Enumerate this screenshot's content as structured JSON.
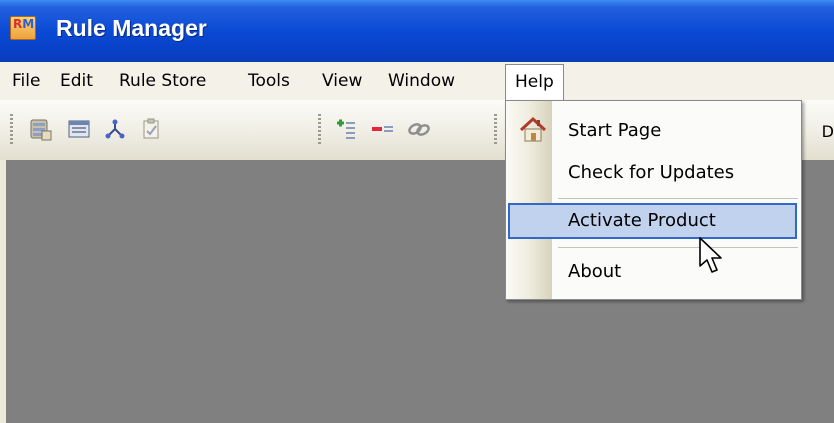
{
  "window": {
    "app_icon_text_r": "R",
    "app_icon_text_m": "M",
    "title": "Rule Manager"
  },
  "menubar": {
    "items": [
      {
        "label": "File"
      },
      {
        "label": "Edit"
      },
      {
        "label": "Rule Store"
      },
      {
        "label": "Tools"
      },
      {
        "label": "View"
      },
      {
        "label": "Window"
      },
      {
        "label": "Help"
      }
    ]
  },
  "toolbar": {
    "icons": [
      "database-icon",
      "window-icon",
      "nodes-icon",
      "checklist-icon",
      "add-rule-icon",
      "remove-rule-icon",
      "link-icon"
    ],
    "edge_text": "D"
  },
  "help_menu": {
    "items": [
      {
        "label": "Start Page",
        "icon": "home-icon"
      },
      {
        "label": "Check for Updates"
      },
      {
        "label": "Activate Product",
        "highlighted": true
      },
      {
        "label": "About"
      }
    ]
  },
  "colors": {
    "titlebar": "#0b4ad4",
    "workspace": "#808080",
    "menu_highlight": "#c1d2ee",
    "menu_highlight_border": "#3169c6"
  }
}
